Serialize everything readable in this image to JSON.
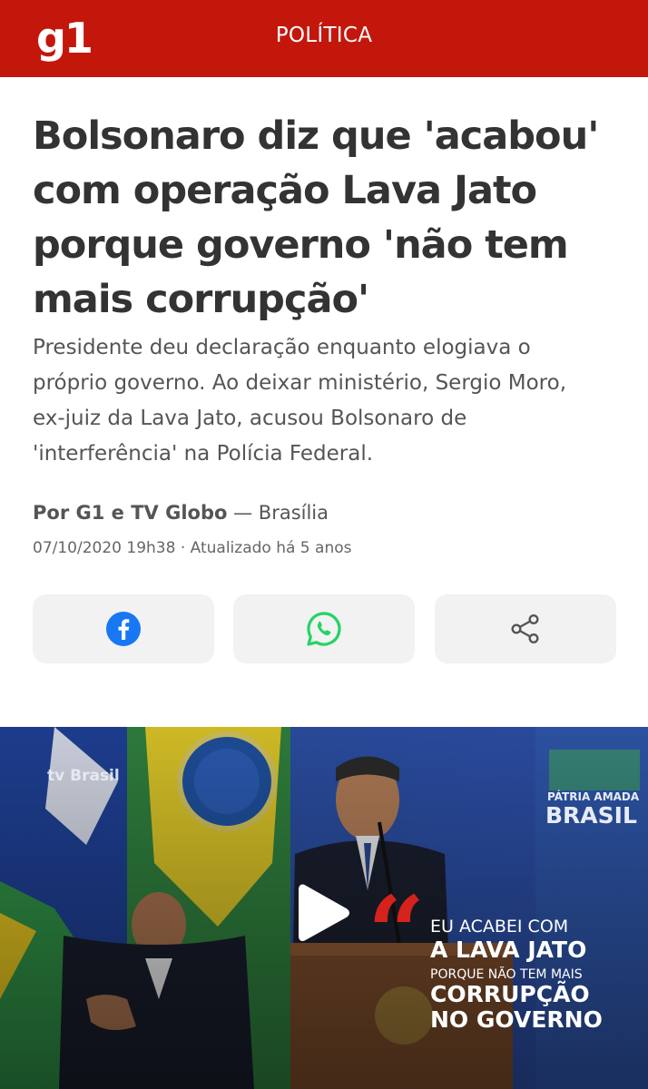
{
  "header": {
    "logo": "g1",
    "section": "POLÍTICA",
    "colors": {
      "brand_red": "#c4170c"
    }
  },
  "article": {
    "headline_lines": [
      "Bolsonaro diz que 'acabou'",
      "com operação Lava Jato",
      "porque governo 'não tem",
      "mais corrupção'"
    ],
    "subtitle_lines": [
      "Presidente deu declaração enquanto elogiava o",
      "próprio governo. Ao deixar ministério, Sergio Moro,",
      "ex-juiz da Lava Jato, acusou Bolsonaro de",
      "'interferência' na Polícia Federal."
    ],
    "byline_author": "Por G1 e TV Globo",
    "byline_location": "— Brasília",
    "meta": "07/10/2020 19h38 · Atualizado há 5 anos"
  },
  "share": {
    "buttons": [
      {
        "icon": "facebook-icon",
        "color": "#1877f2"
      },
      {
        "icon": "whatsapp-icon",
        "color": "#25d366"
      },
      {
        "icon": "share-icon",
        "color": "#555555"
      }
    ]
  },
  "video": {
    "tv_logo": "tv Brasil",
    "banner_line1": "PÁTRIA AMADA",
    "banner_line2": "BRASIL",
    "caption_lines": [
      "EU ACABEI COM",
      "A LAVA JATO",
      "PORQUE NÃO TEM MAIS",
      "CORRUPÇÃO",
      "NO GOVERNO"
    ],
    "icon": "play-icon"
  }
}
